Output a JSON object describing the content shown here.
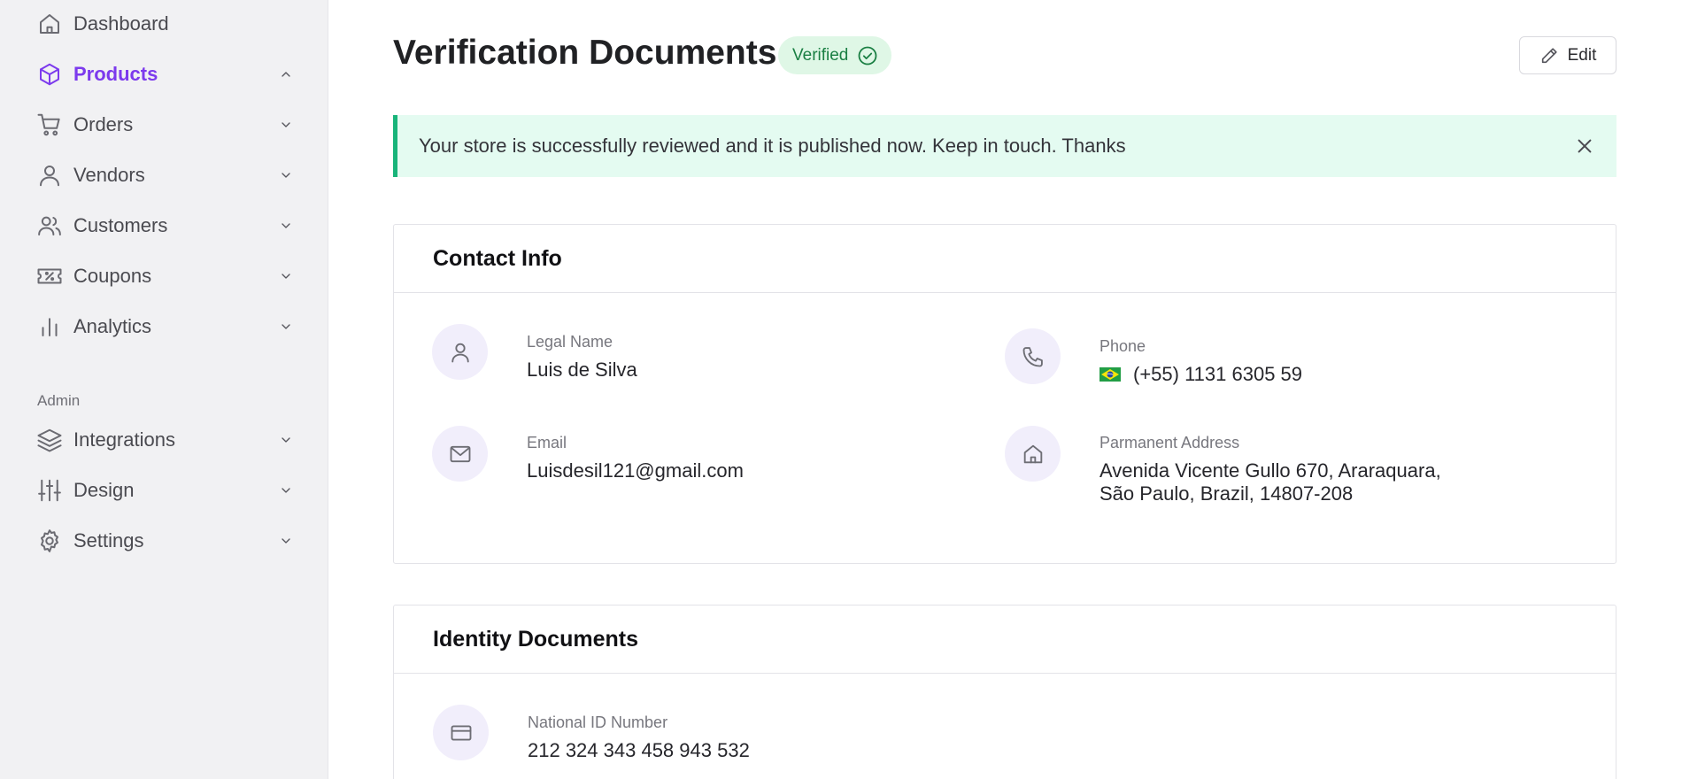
{
  "sidebar": {
    "items": [
      {
        "label": "Dashboard",
        "icon": "home-icon"
      },
      {
        "label": "Products",
        "icon": "box-icon",
        "active": true
      },
      {
        "label": "Orders",
        "icon": "cart-icon"
      },
      {
        "label": "Vendors",
        "icon": "user-icon"
      },
      {
        "label": "Customers",
        "icon": "users-icon"
      },
      {
        "label": "Coupons",
        "icon": "coupon-icon"
      },
      {
        "label": "Analytics",
        "icon": "bar-chart-icon"
      }
    ],
    "admin_label": "Admin",
    "admin_items": [
      {
        "label": "Integrations",
        "icon": "layers-icon"
      },
      {
        "label": "Design",
        "icon": "sliders-icon"
      },
      {
        "label": "Settings",
        "icon": "gear-icon"
      }
    ]
  },
  "header": {
    "title": "Verification Documents",
    "badge": "Verified",
    "edit_label": "Edit"
  },
  "alert": {
    "message": "Your store is successfully reviewed and it is published now. Keep in touch. Thanks"
  },
  "contact": {
    "title": "Contact Info",
    "legal_name_label": "Legal Name",
    "legal_name": "Luis de Silva",
    "phone_label": "Phone",
    "phone": "(+55) 1131 6305 59",
    "email_label": "Email",
    "email": "Luisdesil121@gmail.com",
    "address_label": "Parmanent Address",
    "address_line1": "Avenida Vicente Gullo 670, Araraquara,",
    "address_line2": "São Paulo, Brazil, 14807-208"
  },
  "identity": {
    "title": "Identity Documents",
    "national_id_label": "National ID Number",
    "national_id": "212 324 343 458 943 532"
  },
  "colors": {
    "accent": "#7c3aed",
    "success": "#1a7f43",
    "alert_bg": "#e4fbf1",
    "alert_border": "#18b47a"
  }
}
